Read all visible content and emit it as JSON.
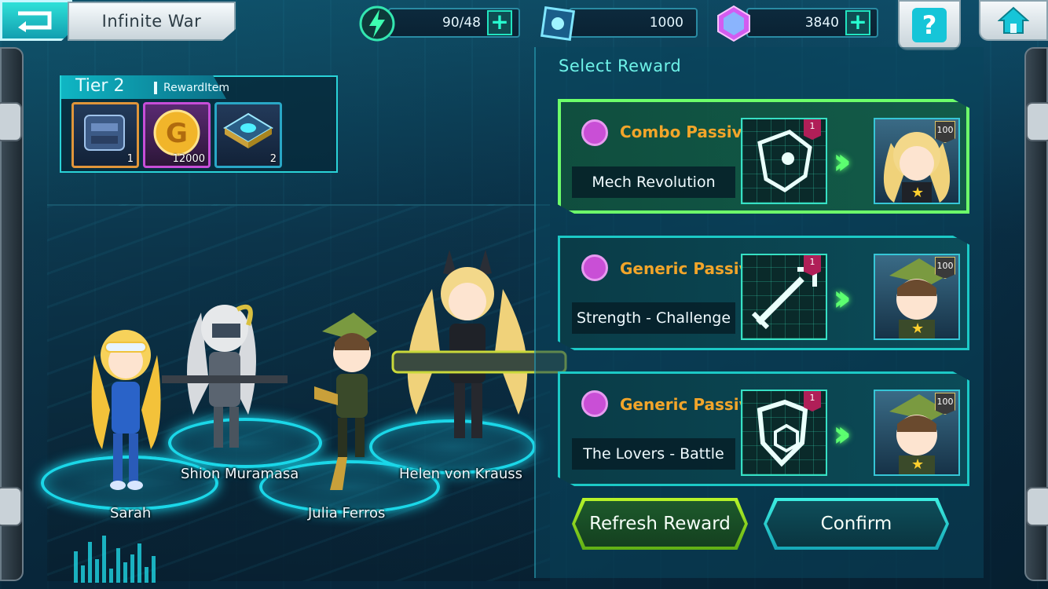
{
  "topbar": {
    "title": "Infinite War",
    "stamina": "90/48",
    "crystal": "1000",
    "gems": "3840",
    "help_label": "?"
  },
  "tier": {
    "label": "Tier 2",
    "sub": "RewardItem",
    "items": [
      {
        "name": "mech-parts",
        "qty": "1"
      },
      {
        "name": "gold-coin",
        "qty": "12000"
      },
      {
        "name": "chip",
        "qty": "2"
      }
    ]
  },
  "characters": [
    {
      "name": "Sarah"
    },
    {
      "name": "Shion Muramasa"
    },
    {
      "name": "Julia Ferros"
    },
    {
      "name": "Helen von Krauss"
    }
  ],
  "panel": {
    "title": "Select Reward",
    "rewards": [
      {
        "type": "Combo Passive",
        "skill": "Mech Revolution",
        "skill_level": "1",
        "char_level": "100",
        "selected": true
      },
      {
        "type": "Generic Passive",
        "skill": "Strength - Challenge",
        "skill_level": "1",
        "char_level": "100",
        "selected": false
      },
      {
        "type": "Generic Passive",
        "skill": "The Lovers - Battle",
        "skill_level": "1",
        "char_level": "100",
        "selected": false
      }
    ],
    "refresh_label": "Refresh Reward",
    "confirm_label": "Confirm"
  },
  "colors": {
    "accent": "#1cc9c6",
    "selected": "#6dff6a",
    "passive_type": "#f2a52a"
  }
}
